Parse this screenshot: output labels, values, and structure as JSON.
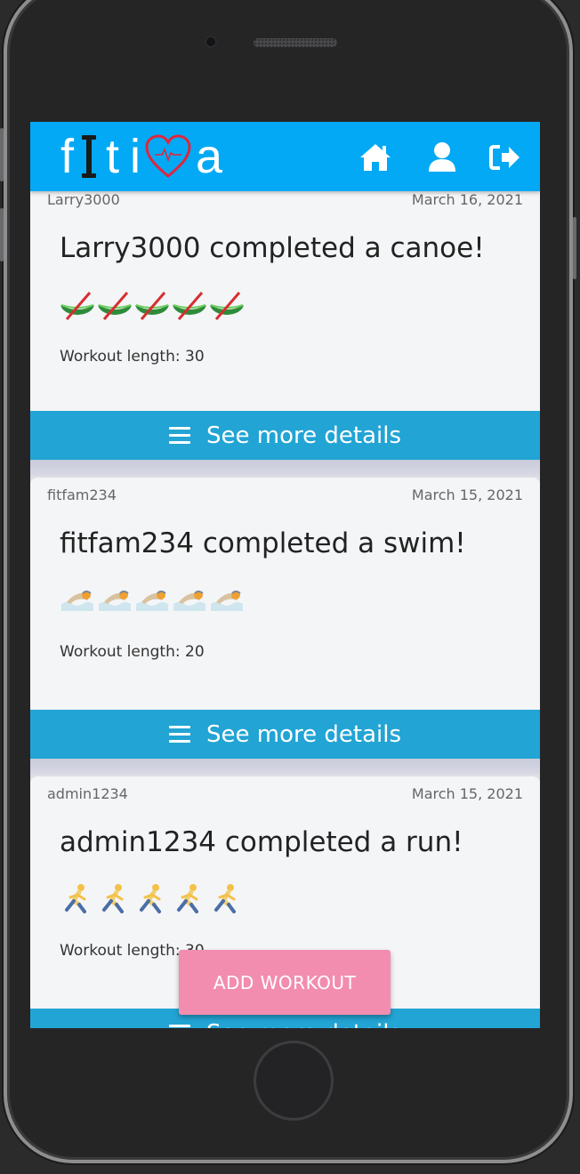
{
  "app": {
    "logo_letters": [
      "f",
      "t",
      "i",
      "a"
    ]
  },
  "nav": {
    "home_icon": "home-icon",
    "profile_icon": "user-icon",
    "logout_icon": "sign-out-icon"
  },
  "colors": {
    "navbar": "#03a9f4",
    "details_button": "#22a4d4",
    "fab": "#f28daf"
  },
  "feed": [
    {
      "user": "Larry3000",
      "date": "March 16, 2021",
      "title": "Larry3000 completed a canoe!",
      "emoji": "canoe",
      "emoji_count": 5,
      "length": "Workout length: 30",
      "button": "See more details"
    },
    {
      "user": "fitfam234",
      "date": "March 15, 2021",
      "title": "fitfam234 completed a swim!",
      "emoji": "swimmer",
      "emoji_count": 5,
      "length": "Workout length: 20",
      "button": "See more details"
    },
    {
      "user": "admin1234",
      "date": "March 15, 2021",
      "title": "admin1234 completed a run!",
      "emoji": "runner",
      "emoji_count": 5,
      "length": "Workout length: 30",
      "button": "See more details"
    }
  ],
  "fab": {
    "label": "ADD WORKOUT"
  }
}
